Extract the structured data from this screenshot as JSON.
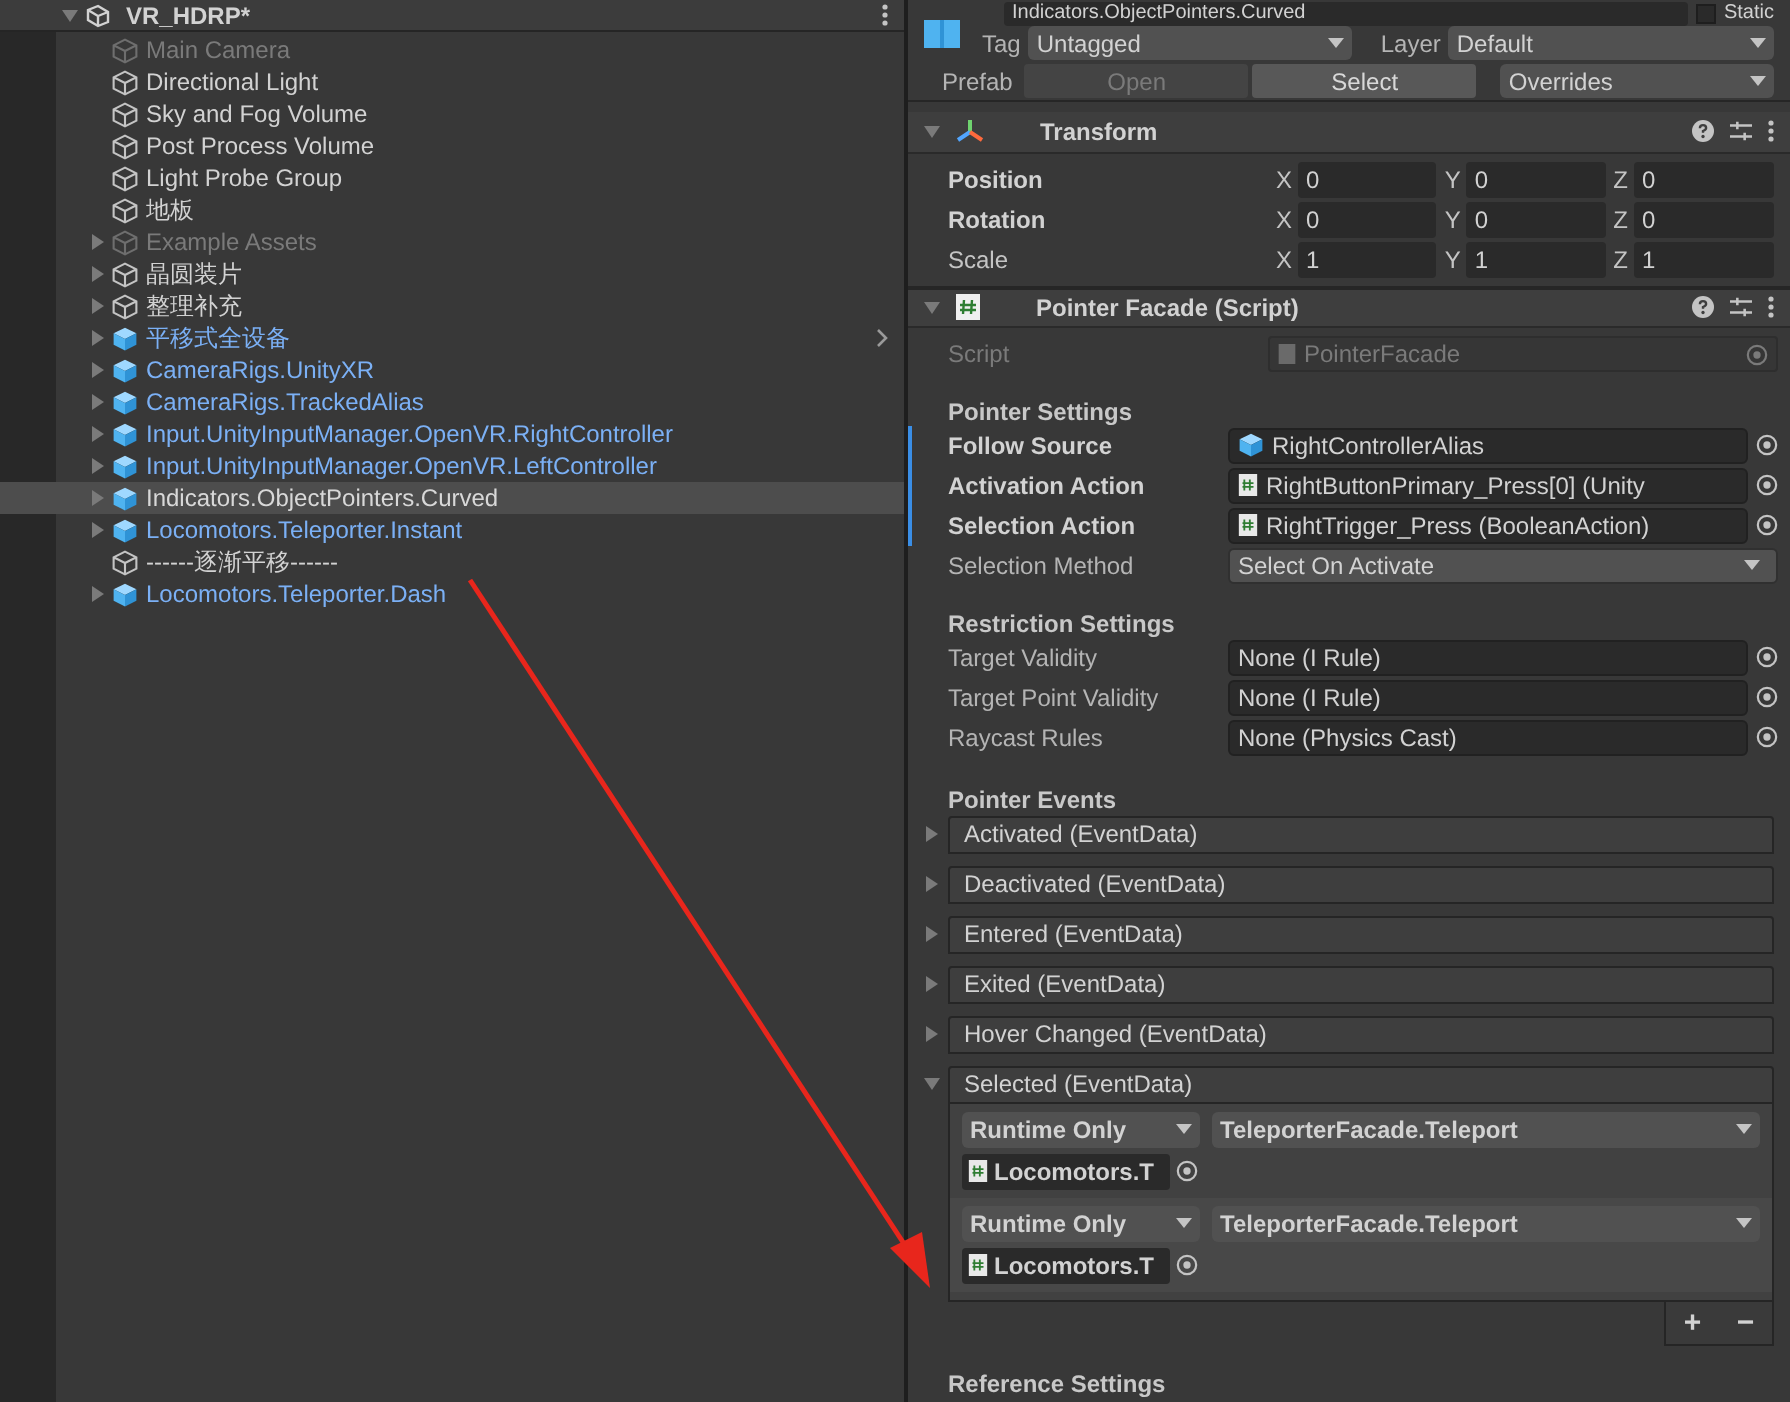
{
  "hierarchy": {
    "scene": "VR_HDRP*",
    "items": [
      {
        "name": "Main Camera",
        "kind": "object",
        "dimmed": true,
        "expandable": false,
        "selected": false,
        "side_arrow": false
      },
      {
        "name": "Directional Light",
        "kind": "object",
        "dimmed": false,
        "expandable": false,
        "selected": false,
        "side_arrow": false
      },
      {
        "name": "Sky and Fog Volume",
        "kind": "object",
        "dimmed": false,
        "expandable": false,
        "selected": false,
        "side_arrow": false
      },
      {
        "name": "Post Process Volume",
        "kind": "object",
        "dimmed": false,
        "expandable": false,
        "selected": false,
        "side_arrow": false
      },
      {
        "name": "Light Probe Group",
        "kind": "object",
        "dimmed": false,
        "expandable": false,
        "selected": false,
        "side_arrow": false
      },
      {
        "name": "地板",
        "kind": "object",
        "dimmed": false,
        "expandable": false,
        "selected": false,
        "side_arrow": false
      },
      {
        "name": "Example Assets",
        "kind": "object",
        "dimmed": true,
        "expandable": true,
        "selected": false,
        "side_arrow": false
      },
      {
        "name": "晶圆装片",
        "kind": "object",
        "dimmed": false,
        "expandable": true,
        "selected": false,
        "side_arrow": false
      },
      {
        "name": "整理补充",
        "kind": "object",
        "dimmed": false,
        "expandable": true,
        "selected": false,
        "side_arrow": false
      },
      {
        "name": "平移式全设备",
        "kind": "prefab",
        "dimmed": false,
        "expandable": true,
        "selected": false,
        "side_arrow": true
      },
      {
        "name": "CameraRigs.UnityXR",
        "kind": "prefab",
        "dimmed": false,
        "expandable": true,
        "selected": false,
        "side_arrow": false
      },
      {
        "name": "CameraRigs.TrackedAlias",
        "kind": "prefab",
        "dimmed": false,
        "expandable": true,
        "selected": false,
        "side_arrow": false
      },
      {
        "name": "Input.UnityInputManager.OpenVR.RightController",
        "kind": "prefab",
        "dimmed": false,
        "expandable": true,
        "selected": false,
        "side_arrow": false
      },
      {
        "name": "Input.UnityInputManager.OpenVR.LeftController",
        "kind": "prefab",
        "dimmed": false,
        "expandable": true,
        "selected": false,
        "side_arrow": false
      },
      {
        "name": "Indicators.ObjectPointers.Curved",
        "kind": "prefab",
        "dimmed": false,
        "expandable": true,
        "selected": true,
        "side_arrow": false
      },
      {
        "name": "Locomotors.Teleporter.Instant",
        "kind": "prefab",
        "dimmed": false,
        "expandable": true,
        "selected": false,
        "side_arrow": false
      },
      {
        "name": "------逐渐平移------",
        "kind": "object",
        "dimmed": false,
        "expandable": false,
        "selected": false,
        "side_arrow": false
      },
      {
        "name": "Locomotors.Teleporter.Dash",
        "kind": "prefab",
        "dimmed": false,
        "expandable": true,
        "selected": false,
        "side_arrow": false
      }
    ]
  },
  "inspector": {
    "object_name": "Indicators.ObjectPointers.Curved",
    "static_label": "Static",
    "static": false,
    "tag_label": "Tag",
    "tag_value": "Untagged",
    "layer_label": "Layer",
    "layer_value": "Default",
    "prefab_label": "Prefab",
    "prefab_buttons": [
      {
        "label": "Open",
        "disabled": true
      },
      {
        "label": "Select",
        "disabled": false
      }
    ],
    "overrides": "Overrides",
    "transform": {
      "title": "Transform",
      "rows": [
        {
          "label": "Position",
          "modified": true,
          "values": [
            {
              "axis": "X",
              "value": "0"
            },
            {
              "axis": "Y",
              "value": "0"
            },
            {
              "axis": "Z",
              "value": "0"
            }
          ]
        },
        {
          "label": "Rotation",
          "modified": true,
          "values": [
            {
              "axis": "X",
              "value": "0"
            },
            {
              "axis": "Y",
              "value": "0"
            },
            {
              "axis": "Z",
              "value": "0"
            }
          ]
        },
        {
          "label": "Scale",
          "modified": false,
          "values": [
            {
              "axis": "X",
              "value": "1"
            },
            {
              "axis": "Y",
              "value": "1"
            },
            {
              "axis": "Z",
              "value": "1"
            }
          ]
        }
      ]
    },
    "pointer_facade": {
      "title": "Pointer Facade (Script)",
      "script_label": "Script",
      "script_value": "PointerFacade",
      "sections": [
        {
          "title": "Pointer Settings",
          "fields": [
            {
              "label": "Follow Source",
              "value": "RightControllerAlias",
              "kind": "object",
              "modified": true
            },
            {
              "label": "Activation Action",
              "value": "RightButtonPrimary_Press[0] (Unity",
              "kind": "script",
              "modified": true
            },
            {
              "label": "Selection Action",
              "value": "RightTrigger_Press (BooleanAction)",
              "kind": "script",
              "modified": true
            },
            {
              "label": "Selection Method",
              "value": "Select On Activate",
              "kind": "dropdown",
              "modified": false
            }
          ]
        },
        {
          "title": "Restriction Settings",
          "fields": [
            {
              "label": "Target Validity",
              "value": "None (I Rule)",
              "kind": "none",
              "modified": false
            },
            {
              "label": "Target Point Validity",
              "value": "None (I Rule)",
              "kind": "none",
              "modified": false
            },
            {
              "label": "Raycast Rules",
              "value": "None (Physics Cast)",
              "kind": "none",
              "modified": false
            }
          ]
        }
      ],
      "events_title": "Pointer Events",
      "events": [
        {
          "label": "Activated (EventData)",
          "expanded": false
        },
        {
          "label": "Deactivated (EventData)",
          "expanded": false
        },
        {
          "label": "Entered (EventData)",
          "expanded": false
        },
        {
          "label": "Exited (EventData)",
          "expanded": false
        },
        {
          "label": "Hover Changed (EventData)",
          "expanded": false
        },
        {
          "label": "Selected (EventData)",
          "expanded": true
        }
      ],
      "listeners": [
        {
          "mode": "Runtime Only",
          "function": "TeleporterFacade.Teleport",
          "target": "Locomotors.T",
          "selected": false
        },
        {
          "mode": "Runtime Only",
          "function": "TeleporterFacade.Teleport",
          "target": "Locomotors.T",
          "selected": true
        }
      ],
      "add_label": "+",
      "remove_label": "−",
      "reference_title": "Reference Settings"
    }
  }
}
